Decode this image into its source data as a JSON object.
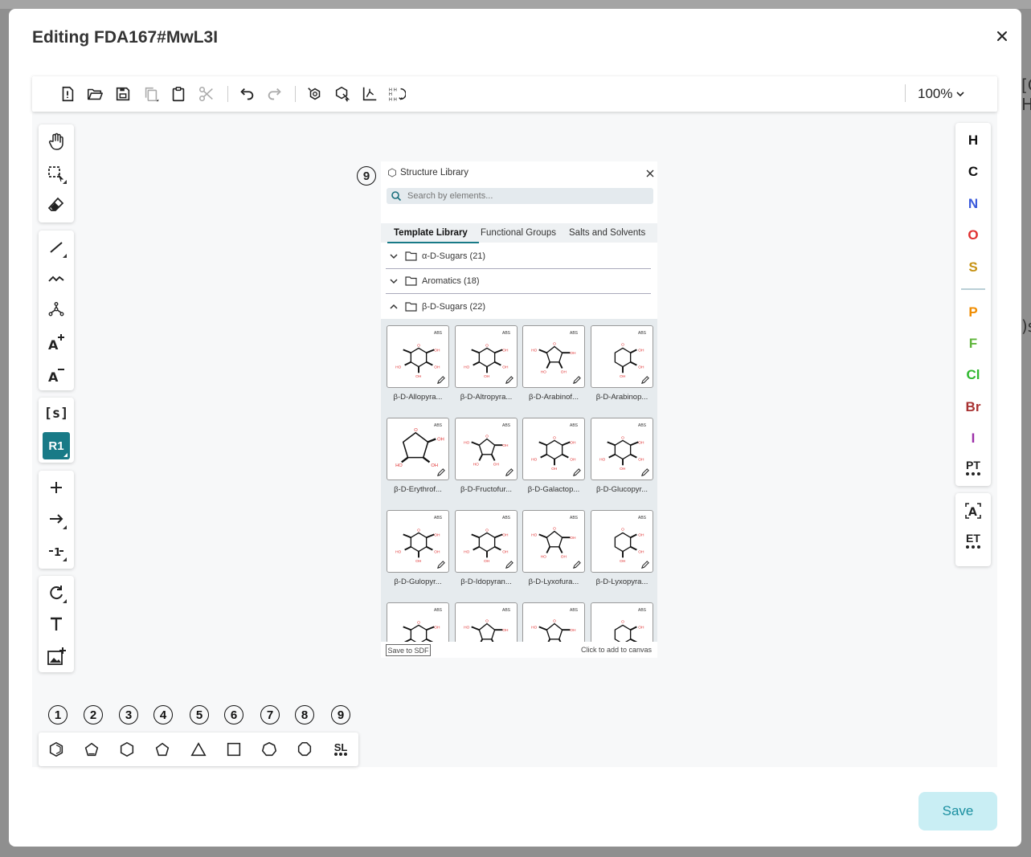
{
  "modal": {
    "title": "Editing FDA167#MwL3I",
    "save_label": "Save"
  },
  "background": {
    "right_text_1": "[C",
    "right_text_2": "H]",
    "right_text_3": ")s"
  },
  "toolbar": {
    "zoom": "100%"
  },
  "elements": [
    {
      "symbol": "H",
      "color": "#111111"
    },
    {
      "symbol": "C",
      "color": "#111111"
    },
    {
      "symbol": "N",
      "color": "#3b5bdb"
    },
    {
      "symbol": "O",
      "color": "#e03131"
    },
    {
      "symbol": "S",
      "color": "#c69214"
    },
    {
      "symbol": "P",
      "color": "#f08c00"
    },
    {
      "symbol": "F",
      "color": "#5fb53b"
    },
    {
      "symbol": "Cl",
      "color": "#2fb82f"
    },
    {
      "symbol": "Br",
      "color": "#a83232"
    },
    {
      "symbol": "I",
      "color": "#9c2fa8"
    }
  ],
  "right_tools": {
    "periodic_table": "PT",
    "extended_table": "ET",
    "atom_label": "A"
  },
  "left_tools": {
    "rgroup_label": "R1",
    "sgroup_label": "[s]"
  },
  "bottom_numbers": [
    "1",
    "2",
    "3",
    "4",
    "5",
    "6",
    "7",
    "8",
    "9"
  ],
  "bottom_tools": {
    "structure_library_label": "SL"
  },
  "structure_library": {
    "marker": "9",
    "title": "Structure Library",
    "search_placeholder": "Search by elements...",
    "tabs": [
      "Template Library",
      "Functional Groups",
      "Salts and Solvents"
    ],
    "groups": [
      {
        "label": "α-D-Sugars (21)",
        "expanded": false
      },
      {
        "label": "Aromatics (18)",
        "expanded": false
      },
      {
        "label": "β-D-Sugars (22)",
        "expanded": true
      }
    ],
    "templates": [
      {
        "name": "β-D-Allopyra...",
        "tag": "ABS",
        "ring": "hex"
      },
      {
        "name": "β-D-Altropyra...",
        "tag": "ABS",
        "ring": "hex"
      },
      {
        "name": "β-D-Arabinof...",
        "tag": "ABS",
        "ring": "pent"
      },
      {
        "name": "β-D-Arabinop...",
        "tag": "ABS",
        "ring": "hexv"
      },
      {
        "name": "β-D-Erythrof...",
        "tag": "ABS",
        "ring": "pentbig"
      },
      {
        "name": "β-D-Fructofur...",
        "tag": "ABS",
        "ring": "pent"
      },
      {
        "name": "β-D-Galactop...",
        "tag": "ABS",
        "ring": "hex"
      },
      {
        "name": "β-D-Glucopyr...",
        "tag": "ABS",
        "ring": "hex"
      },
      {
        "name": "β-D-Gulopyr...",
        "tag": "ABS",
        "ring": "hex"
      },
      {
        "name": "β-D-Idopyran...",
        "tag": "ABS",
        "ring": "hex"
      },
      {
        "name": "β-D-Lyxofura...",
        "tag": "ABS",
        "ring": "pent"
      },
      {
        "name": "β-D-Lyxopyra...",
        "tag": "ABS",
        "ring": "hexv"
      },
      {
        "name": "",
        "tag": "ABS",
        "ring": "hex"
      },
      {
        "name": "",
        "tag": "ABS",
        "ring": "pent"
      },
      {
        "name": "",
        "tag": "ABS",
        "ring": "pent"
      },
      {
        "name": "",
        "tag": "ABS",
        "ring": "hexv"
      }
    ],
    "save_sdf_label": "Save to SDF",
    "hint": "Click to add to canvas"
  }
}
